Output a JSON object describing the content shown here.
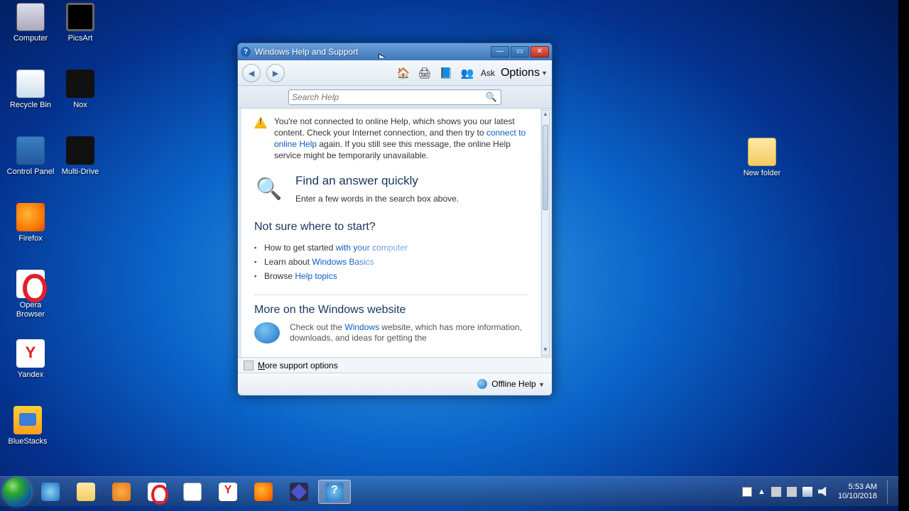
{
  "desktop_icons": {
    "computer": "Computer",
    "picsart": "PicsArt",
    "recycle": "Recycle Bin",
    "nox": "Nox",
    "cpanel": "Control Panel",
    "multi": "Multi-Drive",
    "firefox": "Firefox",
    "opera": "Opera Browser",
    "yandex": "Yandex",
    "bluestacks": "BlueStacks",
    "newfolder": "New folder"
  },
  "window": {
    "title": "Windows Help and Support",
    "toolbar": {
      "ask": "Ask",
      "options": "Options"
    },
    "search_placeholder": "Search Help",
    "warning": {
      "t1": "You're not connected to online Help, which shows you our latest content. Check your Internet connection, and then try to ",
      "link1": "connect to online Help",
      "t2": " again. If you still see this message, the online Help service might be temporarily unavailable."
    },
    "find": {
      "heading": "Find an answer quickly",
      "sub": "Enter a few words in the search box above."
    },
    "start": {
      "heading": "Not sure where to start?",
      "i1a": "How to get started ",
      "i1b": "with your computer",
      "i2a": "Learn about ",
      "i2b": "Windows Basics",
      "i3a": "Browse ",
      "i3b": "Help topics"
    },
    "moreweb": {
      "heading": "More on the Windows website",
      "t1": "Check out the ",
      "link": "Windows",
      "t2": " website, which has more information, downloads, and ideas for getting the"
    },
    "footer": {
      "more_opts_m": "M",
      "more_opts_rest": "ore support options",
      "offline": "Offline Help"
    }
  },
  "tray": {
    "time": "5:53 AM",
    "date": "10/10/2018"
  }
}
